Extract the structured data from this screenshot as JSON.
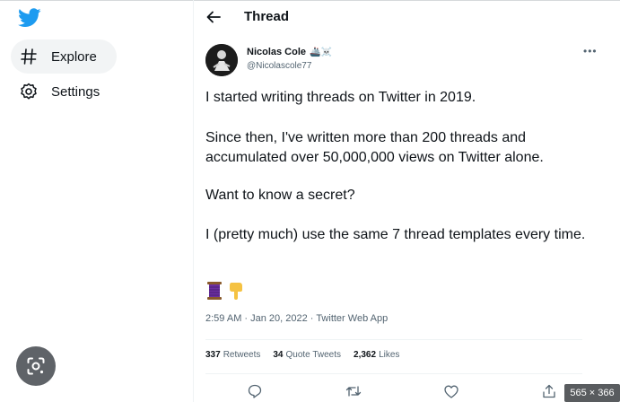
{
  "sidebar": {
    "items": [
      {
        "label": "Explore",
        "icon": "hashtag-icon"
      },
      {
        "label": "Settings",
        "icon": "gear-icon"
      }
    ]
  },
  "header": {
    "title": "Thread"
  },
  "tweet": {
    "author_name": "Nicolas Cole",
    "author_emoji": "🚢☠️",
    "author_handle": "@Nicolascole77",
    "more": "•••",
    "paragraphs": [
      "I started writing threads on Twitter in 2019.",
      "Since then, I've written more than 200 threads and accumulated over 50,000,000 views on Twitter alone.",
      "Want to know a secret?",
      "I (pretty much) use the same 7 thread templates every time."
    ],
    "emojis": [
      "🧵",
      "👇"
    ],
    "timestamp": "2:59 AM · Jan 20, 2022 · Twitter Web App",
    "stats": {
      "retweets_count": "337",
      "retweets_label": "Retweets",
      "quotes_count": "34",
      "quotes_label": "Quote Tweets",
      "likes_count": "2,362",
      "likes_label": "Likes"
    }
  },
  "overlay": {
    "dimensions": "565 × 366"
  },
  "colors": {
    "accent": "#1d9bf0",
    "text": "#0f1419",
    "muted": "#536471"
  }
}
